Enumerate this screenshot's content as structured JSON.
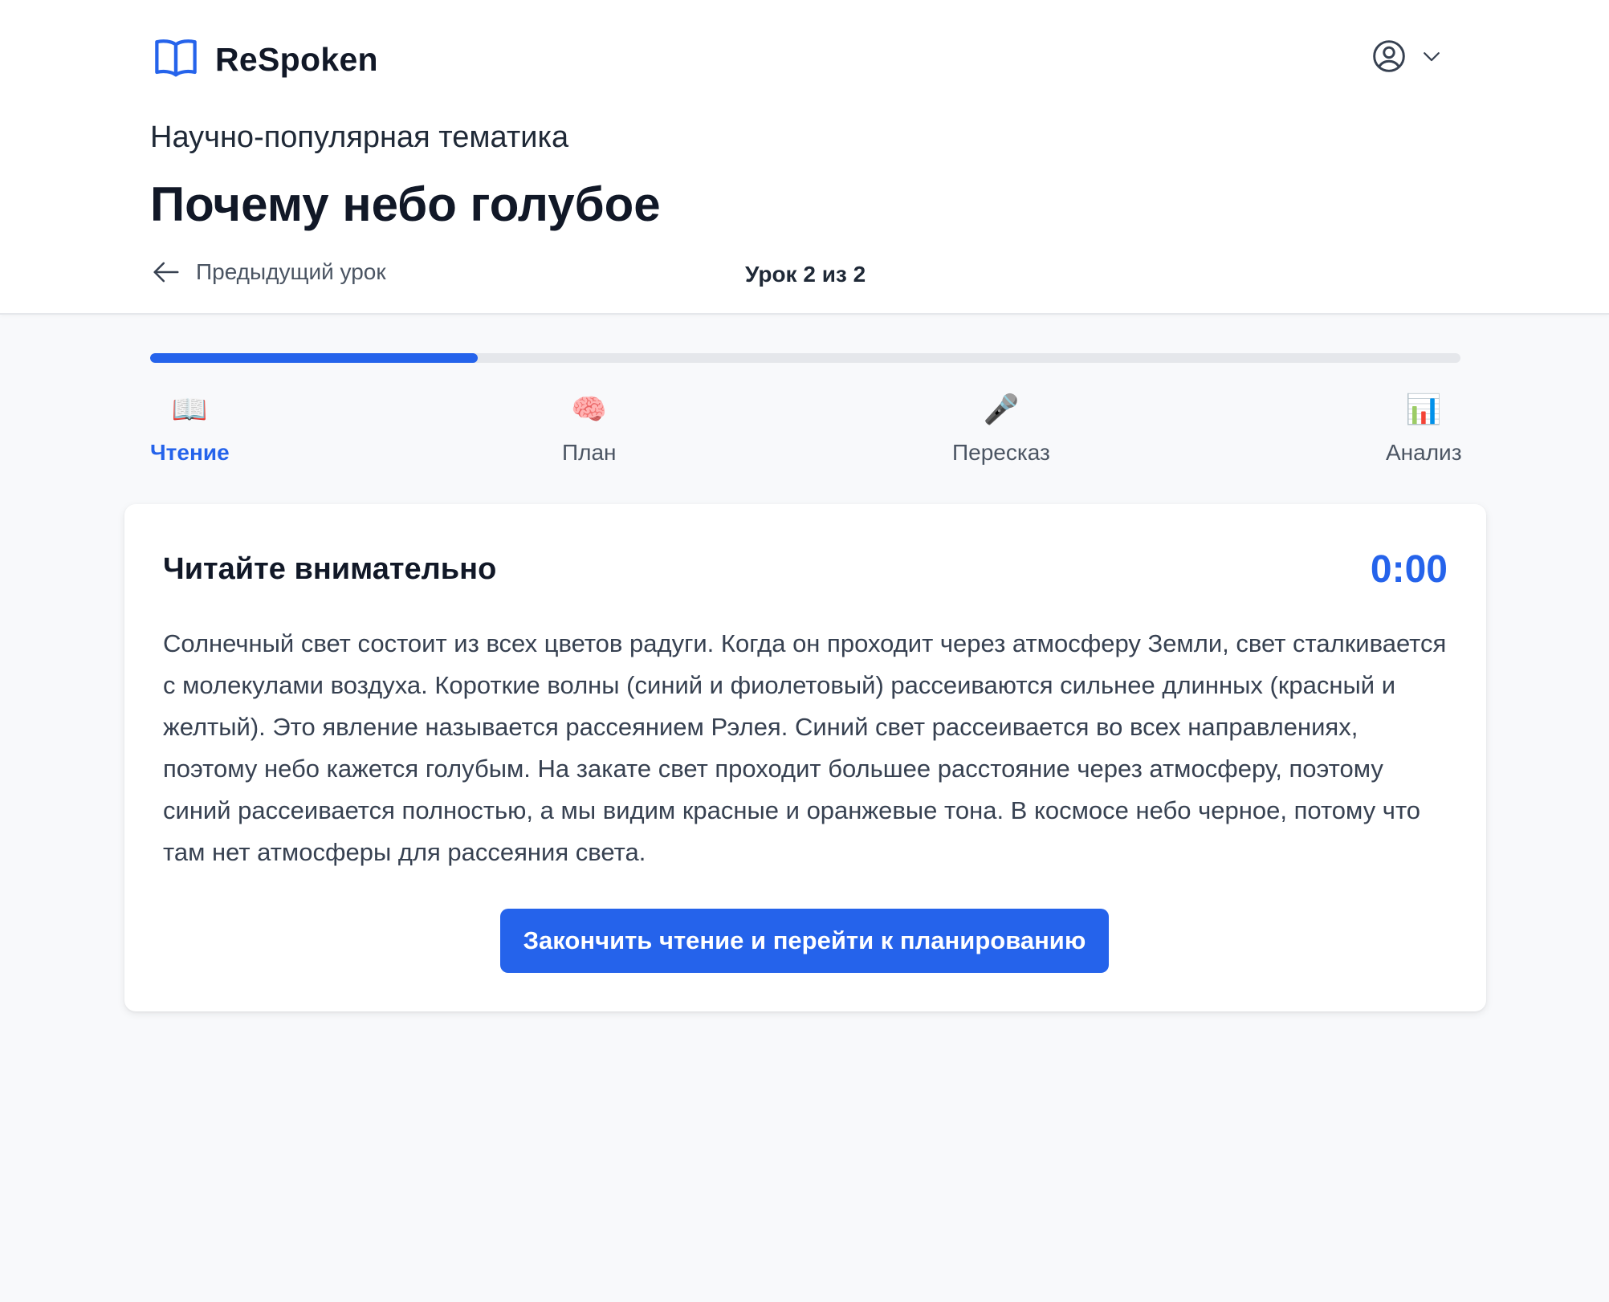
{
  "app": {
    "name": "ReSpoken"
  },
  "lesson": {
    "category": "Научно-популярная тематика",
    "title": "Почему небо голубое",
    "prev_label": "Предыдущий урок",
    "counter": "Урок 2 из 2"
  },
  "progress": {
    "fraction": 0.25,
    "accent": "#2563eb"
  },
  "steps": [
    {
      "icon": "📖",
      "icon_name": "open-book-icon",
      "label": "Чтение",
      "active": true
    },
    {
      "icon": "🧠",
      "icon_name": "brain-icon",
      "label": "План",
      "active": false
    },
    {
      "icon": "🎤",
      "icon_name": "microphone-icon",
      "label": "Пересказ",
      "active": false
    },
    {
      "icon": "📊",
      "icon_name": "bar-chart-icon",
      "label": "Анализ",
      "active": false
    }
  ],
  "reading": {
    "heading": "Читайте внимательно",
    "timer": "0:00",
    "text": "Солнечный свет состоит из всех цветов радуги. Когда он проходит через атмосферу Земли, свет сталкивается с молекулами воздуха. Короткие волны (синий и фиолетовый) рассеиваются сильнее длинных (красный и желтый). Это явление называется рассеянием Рэлея. Синий свет рассеивается во всех направлениях, поэтому небо кажется голубым. На закате свет проходит большее расстояние через атмосферу, поэтому синий рассеивается полностью, а мы видим красные и оранжевые тона. В космосе небо черное, потому что там нет атмосферы для рассеяния света.",
    "finish_button": "Закончить чтение и перейти к планированию"
  }
}
